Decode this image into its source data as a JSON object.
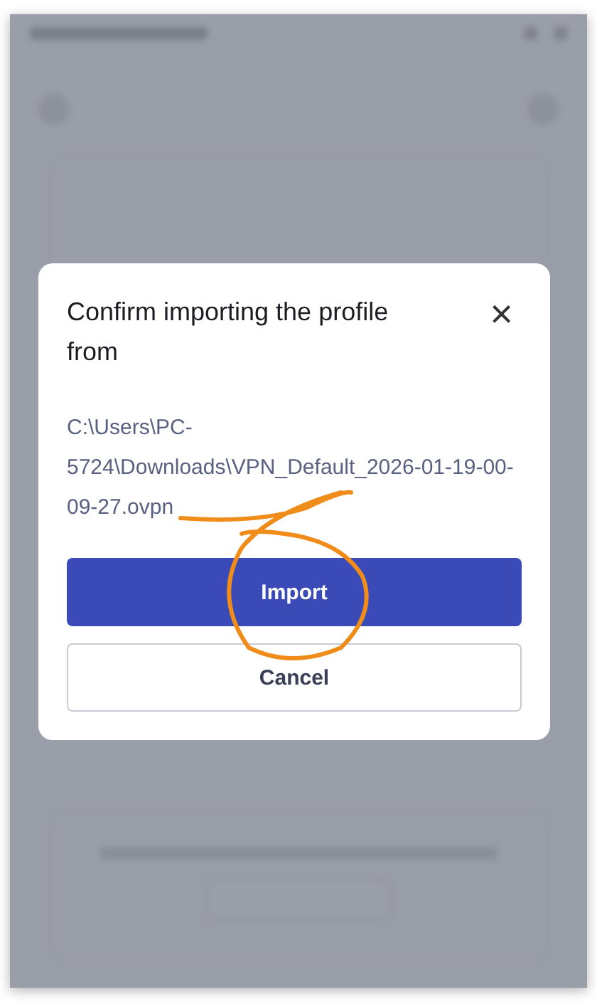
{
  "dialog": {
    "title": "Confirm importing the profile from",
    "path": "C:\\Users\\PC-5724\\Downloads\\VPN_Default_2026-01-19-00-09-27.ovpn",
    "close": "×",
    "buttons": [
      {
        "label": "Import",
        "kind": "primary"
      },
      {
        "label": "Cancel",
        "kind": "secondary"
      }
    ]
  }
}
